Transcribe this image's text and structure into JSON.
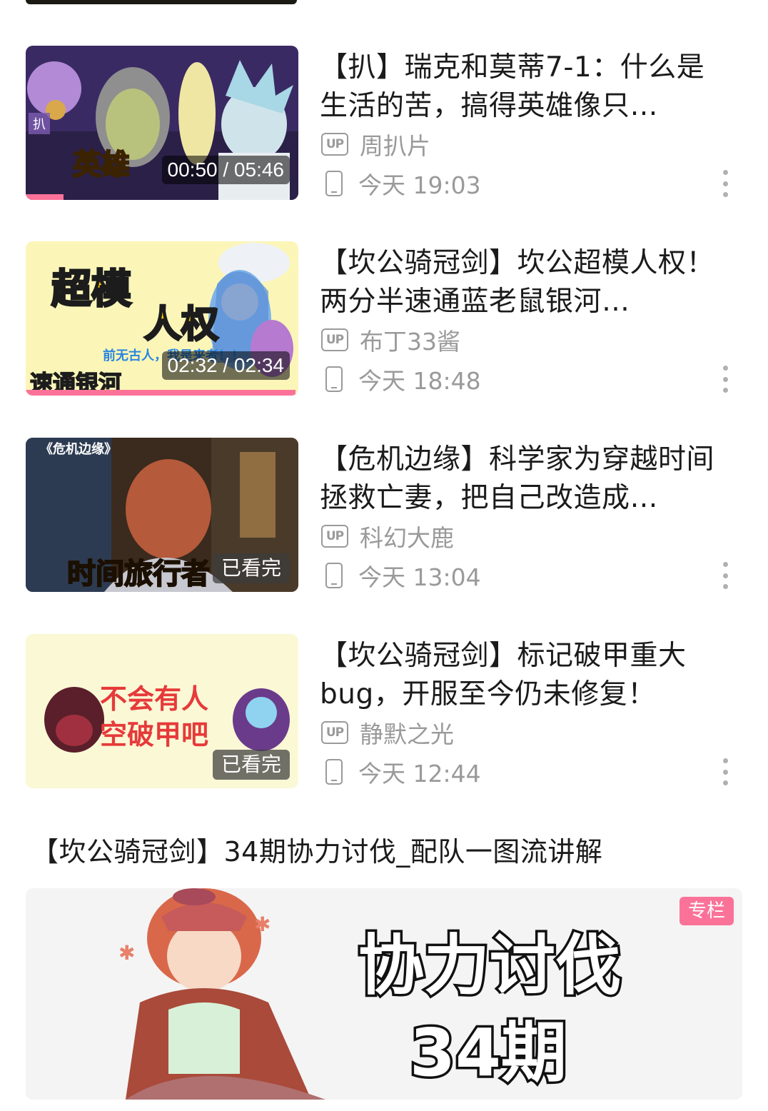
{
  "colors": {
    "accent": "#fb7299",
    "meta_text": "#9a9a9a",
    "title_text": "#1b1b1b"
  },
  "videos": [
    {
      "title": "【扒】瑞克和莫蒂7-1：什么是生活的苦，搞得英雄像只…",
      "uploader": "周扒片",
      "time": "今天 19:03",
      "duration": "00:50 / 05:46",
      "progress": 0.14,
      "thumb_text": [
        "扒",
        "英雄"
      ]
    },
    {
      "title": "【坎公骑冠剑】坎公超模人权！两分半速通蓝老鼠银河…",
      "uploader": "布丁33酱",
      "time": "今天 18:48",
      "duration": "02:32 / 02:34",
      "progress": 0.99,
      "thumb_text": [
        "超模",
        "人权",
        "前无古人，我是来者！！",
        "速通银河"
      ]
    },
    {
      "title": "【危机边缘】科学家为穿越时间拯救亡妻，把自己改造成…",
      "uploader": "科幻大鹿",
      "time": "今天 13:04",
      "watched": "已看完",
      "thumb_text": [
        "《危机边缘》",
        "时间旅行者"
      ]
    },
    {
      "title": "【坎公骑冠剑】标记破甲重大bug，开服至今仍未修复！",
      "uploader": "静默之光",
      "time": "今天 12:44",
      "watched": "已看完",
      "thumb_text": [
        "不会有人",
        "空破甲吧"
      ]
    }
  ],
  "up_label": "UP",
  "article": {
    "title": "【坎公骑冠剑】34期协力讨伐_配队一图流讲解",
    "badge": "专栏",
    "banner_text": [
      "协力讨伐",
      "34期"
    ]
  }
}
